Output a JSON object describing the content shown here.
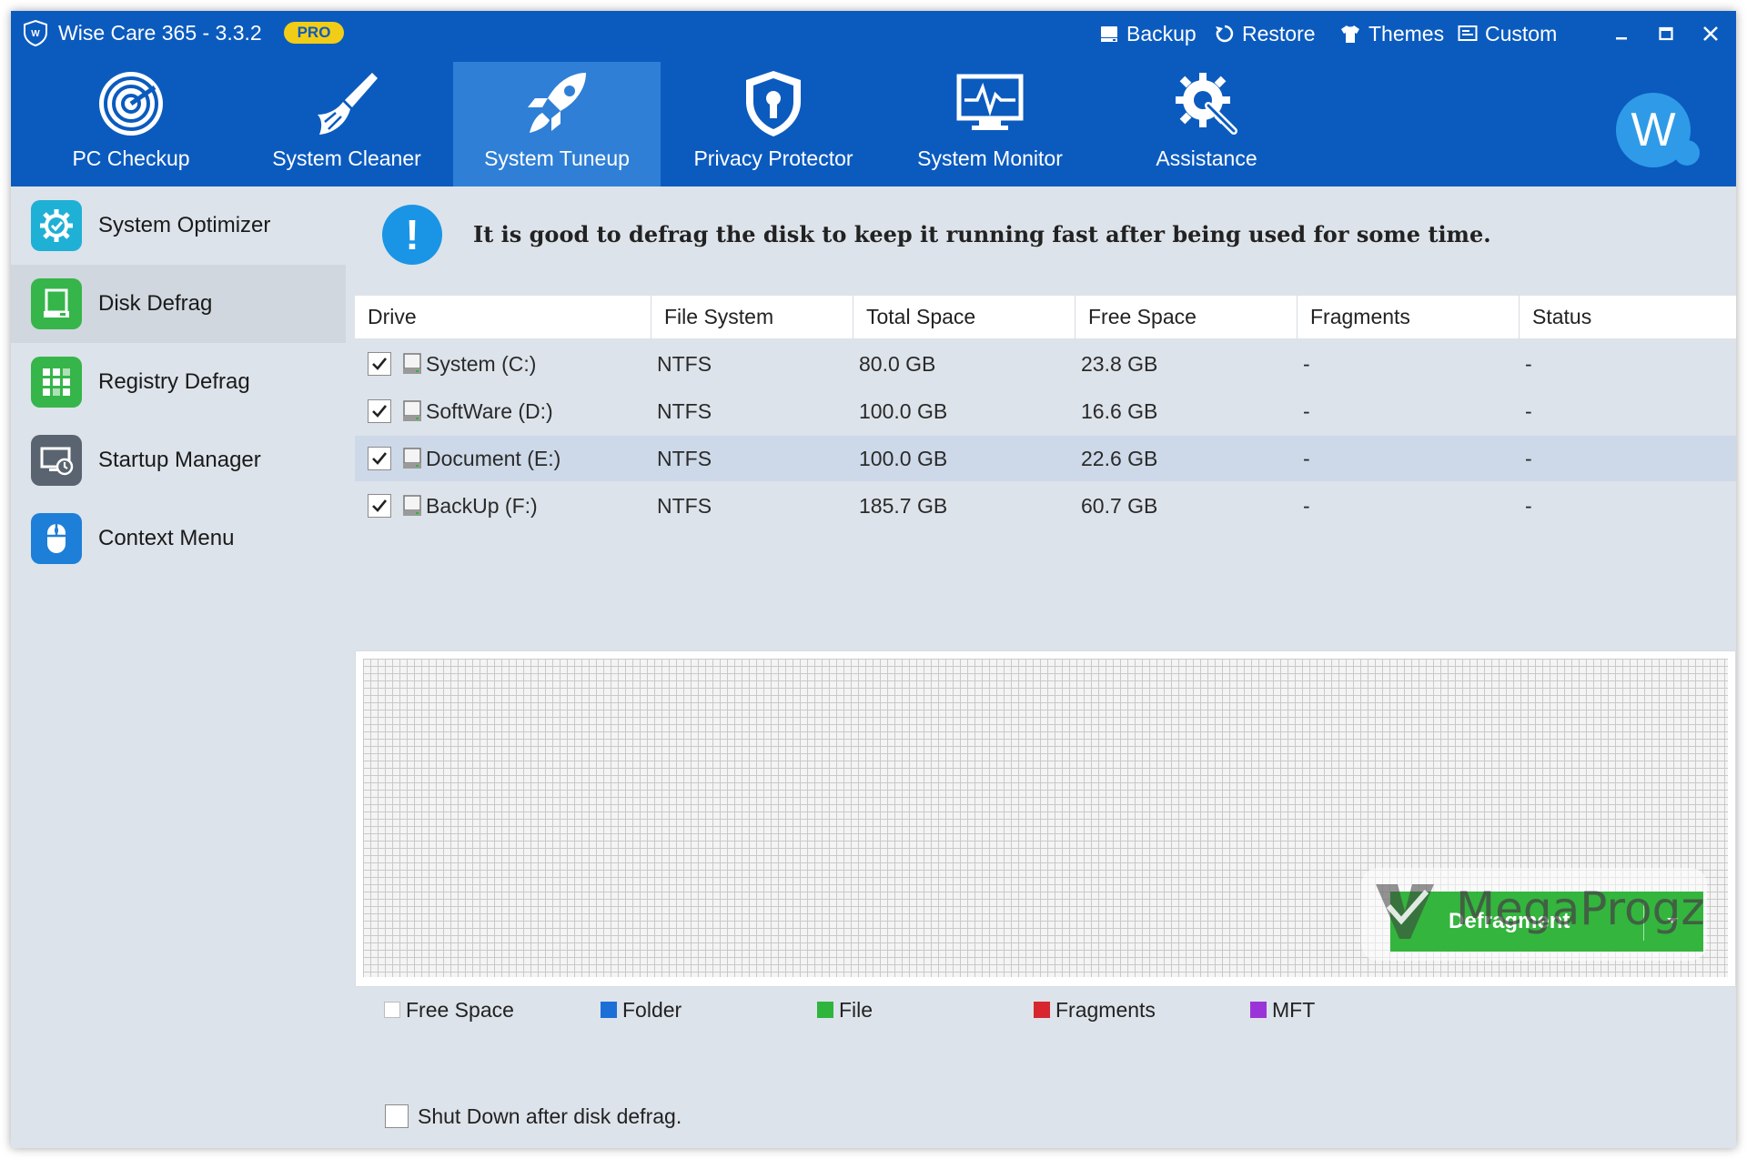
{
  "app": {
    "title": "Wise Care 365 - 3.3.2",
    "badge": "PRO"
  },
  "top_actions": [
    {
      "label": "Backup",
      "icon": "backup-icon"
    },
    {
      "label": "Restore",
      "icon": "restore-icon"
    },
    {
      "label": "Themes",
      "icon": "shirt-icon"
    },
    {
      "label": "Custom",
      "icon": "custom-icon"
    }
  ],
  "window_controls": [
    "minimize",
    "maximize",
    "close"
  ],
  "nav": [
    {
      "label": "PC Checkup",
      "icon": "radar-icon",
      "active": false
    },
    {
      "label": "System Cleaner",
      "icon": "broom-icon",
      "active": false
    },
    {
      "label": "System Tuneup",
      "icon": "rocket-icon",
      "active": true
    },
    {
      "label": "Privacy Protector",
      "icon": "shield-icon",
      "active": false
    },
    {
      "label": "System Monitor",
      "icon": "monitor-pulse-icon",
      "active": false
    },
    {
      "label": "Assistance",
      "icon": "gear-wrench-icon",
      "active": false
    }
  ],
  "user": {
    "avatar_letter": "W"
  },
  "sidebar": [
    {
      "label": "System Optimizer",
      "icon": "optimizer-gear-icon",
      "color": "#1fb0d6",
      "active": false
    },
    {
      "label": "Disk Defrag",
      "icon": "disk-icon",
      "color": "#36b54a",
      "active": true
    },
    {
      "label": "Registry Defrag",
      "icon": "registry-grid-icon",
      "color": "#36b54a",
      "active": false
    },
    {
      "label": "Startup Manager",
      "icon": "startup-monitor-icon",
      "color": "#5a6470",
      "active": false
    },
    {
      "label": "Context Menu",
      "icon": "mouse-icon",
      "color": "#1e7fd8",
      "active": false
    }
  ],
  "info": {
    "message": "It is good to defrag the disk to keep it running fast after being used for some time."
  },
  "table": {
    "columns": [
      "Drive",
      "File System",
      "Total Space",
      "Free Space",
      "Fragments",
      "Status"
    ],
    "rows": [
      {
        "checked": true,
        "drive": "System (C:)",
        "fs": "NTFS",
        "total": "80.0 GB",
        "free": "23.8 GB",
        "fragments": "-",
        "status": "-",
        "selected": false
      },
      {
        "checked": true,
        "drive": "SoftWare (D:)",
        "fs": "NTFS",
        "total": "100.0 GB",
        "free": "16.6 GB",
        "fragments": "-",
        "status": "-",
        "selected": false
      },
      {
        "checked": true,
        "drive": "Document (E:)",
        "fs": "NTFS",
        "total": "100.0 GB",
        "free": "22.6 GB",
        "fragments": "-",
        "status": "-",
        "selected": true
      },
      {
        "checked": true,
        "drive": "BackUp (F:)",
        "fs": "NTFS",
        "total": "185.7 GB",
        "free": "60.7 GB",
        "fragments": "-",
        "status": "-",
        "selected": false
      }
    ]
  },
  "legend": [
    {
      "label": "Free Space",
      "color": "#ffffff"
    },
    {
      "label": "Folder",
      "color": "#1d6fd8"
    },
    {
      "label": "File",
      "color": "#2fb53c"
    },
    {
      "label": "Fragments",
      "color": "#d7262e"
    },
    {
      "label": "MFT",
      "color": "#9b34d8"
    }
  ],
  "shutdown": {
    "label": "Shut Down after disk defrag.",
    "checked": false
  },
  "action": {
    "label": "Defragment"
  },
  "watermark": {
    "text": "MegaProgz"
  }
}
